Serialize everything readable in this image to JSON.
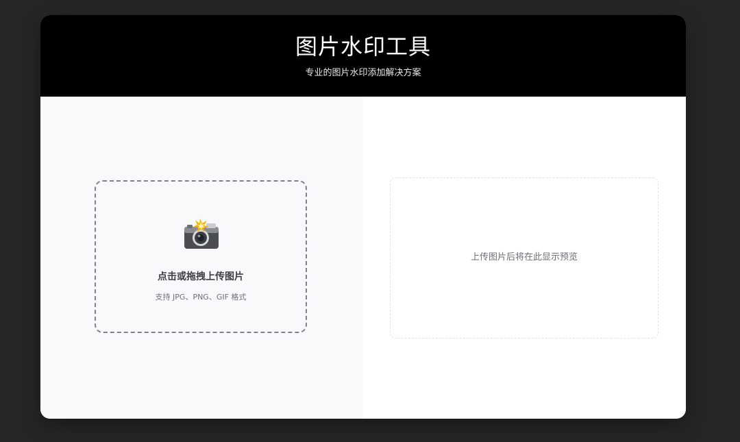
{
  "header": {
    "title": "图片水印工具",
    "subtitle": "专业的图片水印添加解决方案"
  },
  "upload": {
    "icon": "camera-flash-icon",
    "title": "点击或拖拽上传图片",
    "hint": "支持 JPG、PNG、GIF 格式"
  },
  "preview": {
    "placeholder": "上传图片后将在此显示预览"
  },
  "colors": {
    "page_background": "#262626",
    "header_background": "#000000",
    "left_panel_background": "#f7f9fb",
    "upload_border": "#7d8288"
  }
}
